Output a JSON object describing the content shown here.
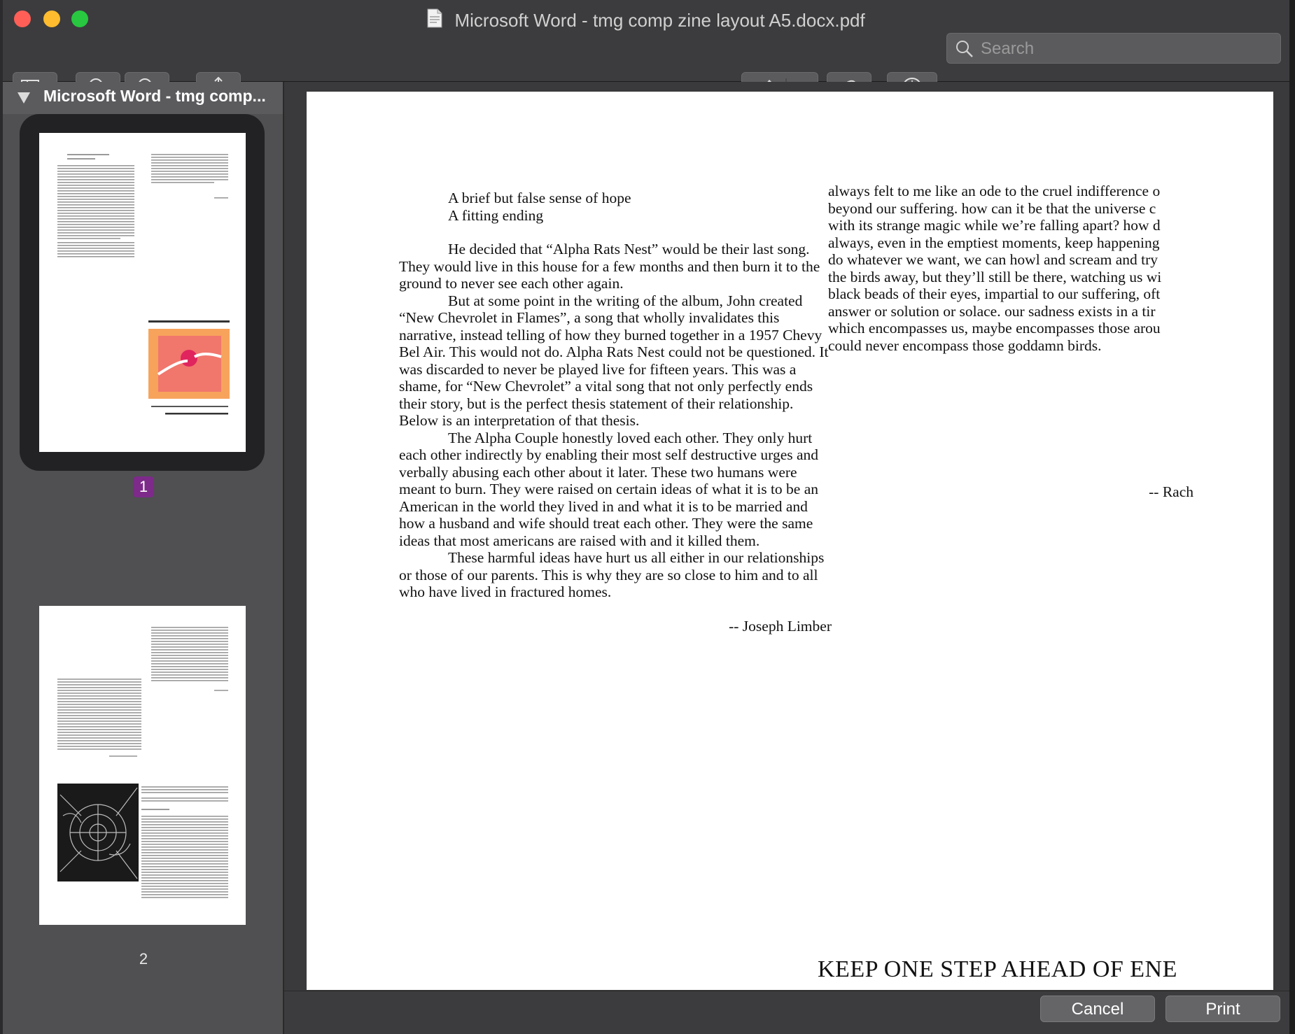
{
  "window": {
    "title": "Microsoft Word - tmg comp zine layout A5.docx.pdf"
  },
  "toolbar": {
    "sidebar_toggle_icon": "sidebar-icon",
    "zoom_out_icon": "zoom-out-icon",
    "zoom_in_icon": "zoom-in-icon",
    "share_icon": "share-icon",
    "markup_icon": "highlighter-icon",
    "rotate_icon": "rotate-icon",
    "annotate_icon": "markup-pen-icon",
    "search_placeholder": "Search"
  },
  "sidebar": {
    "doc_title": "Microsoft Word - tmg comp...",
    "pages": [
      {
        "number": "1",
        "selected": true
      },
      {
        "number": "2",
        "selected": false
      }
    ]
  },
  "document": {
    "colA": {
      "lines": [
        "A brief but false sense of hope",
        "A fitting ending"
      ],
      "paragraphs": [
        "He decided that “Alpha Rats Nest” would be their last song. They would live in this house for a few months and then burn it to the ground to never see each other again.",
        "But at some point in the writing of the album, John created “New Chevrolet in Flames”, a song that wholly invalidates this narrative, instead telling of how they burned together in a 1957 Chevy Bel Air. This would not do. Alpha Rats Nest could not be questioned. It was discarded to never be played live for fifteen years. This was a shame, for “New Chevrolet” a vital song that not only perfectly ends their story, but is the perfect thesis statement of their relationship. Below is an interpretation of that thesis.",
        "The Alpha Couple honestly loved each other. They only hurt each other indirectly by enabling their most self destructive urges and verbally abusing each other about it later. These two humans were meant to burn. They were raised on certain ideas of what it is to be an American in the world they lived in and what it is to be married and how a husband and wife should treat each other. They were the same ideas that most americans are raised with and it killed them.",
        "These harmful ideas have hurt us all either in our relationships or those of our parents. This is why they are so close to him and to all who have lived in fractured homes."
      ],
      "signature": "-- Joseph Limber"
    },
    "colB": {
      "lines": [
        "always felt to me like an ode to the cruel indifference o",
        "beyond our suffering. how can it be that the universe c",
        "with its strange magic while we’re falling apart? how d",
        "always, even in the emptiest moments, keep happening",
        "do whatever we want, we can howl and scream and try",
        "the birds away, but they’ll still be there, watching us wi",
        "black beads of their eyes, impartial to our suffering, oft",
        "answer or solution or solace. our sadness exists in a tir",
        "which encompasses us, maybe encompasses those arou",
        "could never encompass those goddamn birds."
      ],
      "signature": "-- Rach"
    },
    "banner": "KEEP ONE STEP AHEAD OF ENE"
  },
  "footer": {
    "cancel_label": "Cancel",
    "print_label": "Print"
  },
  "colors": {
    "accent_badge": "#7d2a8a",
    "traffic_close": "#ff5f57",
    "traffic_min": "#febc2e",
    "traffic_max": "#28c840"
  }
}
